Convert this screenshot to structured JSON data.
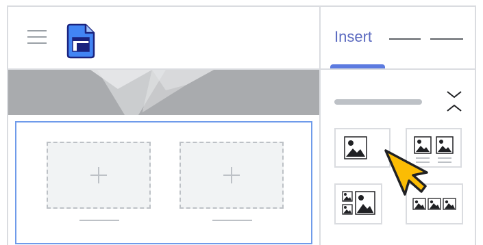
{
  "header": {
    "menu_icon": "hamburger-menu-icon",
    "app_icon": "google-sites-document-icon",
    "accent_color": "#4285f4"
  },
  "panel": {
    "active_tab": "Insert",
    "accent_color": "#5c6bc0",
    "collapse_icon": "chevron-up-down-icon",
    "layouts": [
      {
        "icon": "single-image-layout-icon"
      },
      {
        "icon": "two-image-layout-icon"
      },
      {
        "icon": "image-grid-layout-icon"
      },
      {
        "icon": "three-image-layout-icon"
      }
    ]
  },
  "canvas": {
    "banner_colors": [
      "#a9abae",
      "#c8c9cb",
      "#e2e3e5"
    ],
    "section_border_color": "#6f9bea",
    "slots": [
      {
        "icon": "plus-icon"
      },
      {
        "icon": "plus-icon"
      }
    ]
  },
  "cursor": {
    "icon": "arrow-cursor-icon",
    "color": "#fbbc04"
  }
}
